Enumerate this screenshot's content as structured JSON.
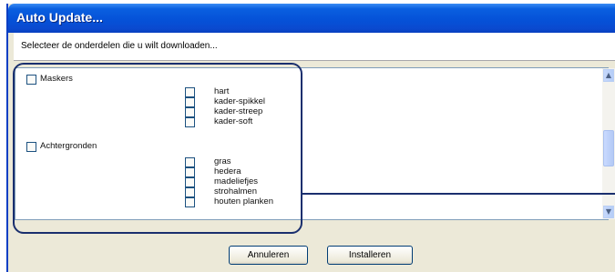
{
  "window": {
    "title": "Auto Update...",
    "instruction": "Selecteer de onderdelen die u wilt downloaden..."
  },
  "list": {
    "groups": [
      {
        "label": "Maskers",
        "checked": false,
        "items": [
          {
            "label": "hart",
            "checked": false
          },
          {
            "label": "kader-spikkel",
            "checked": false
          },
          {
            "label": "kader-streep",
            "checked": false
          },
          {
            "label": "kader-soft",
            "checked": false
          }
        ]
      },
      {
        "label": "Achtergronden",
        "checked": false,
        "items": [
          {
            "label": "gras",
            "checked": false
          },
          {
            "label": "hedera",
            "checked": false
          },
          {
            "label": "madeliefjes",
            "checked": false
          },
          {
            "label": "strohalmen",
            "checked": false
          },
          {
            "label": "houten planken",
            "checked": false
          }
        ]
      }
    ],
    "scroll_up_icon": "chevron-up-icon",
    "scroll_down_icon": "chevron-down-icon"
  },
  "buttons": {
    "cancel": "Annuleren",
    "install": "Installeren"
  },
  "colors": {
    "titlebar": "#0552d8",
    "dialog_bg": "#ece9d8",
    "highlight_outline": "#1a2f6e"
  }
}
